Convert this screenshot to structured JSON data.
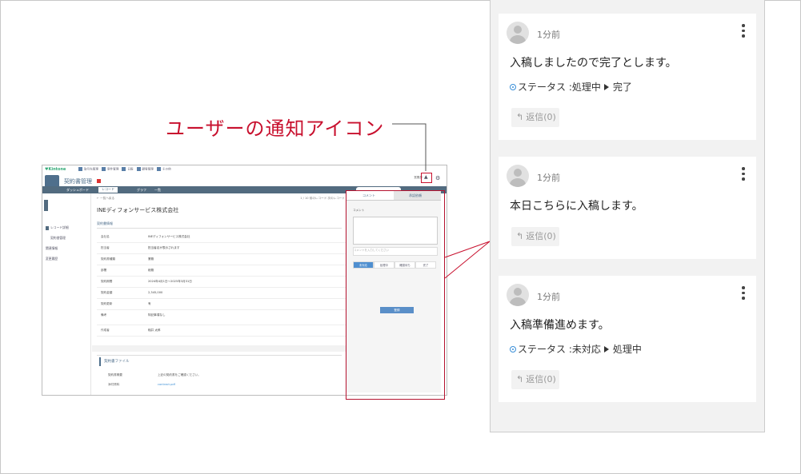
{
  "callout": {
    "label": "ユーザーの通知アイコン"
  },
  "mini_app": {
    "logo": "♥Kintone",
    "top_links": [
      "取引先管理",
      "案件管理",
      "日報",
      "顧客管理",
      "その他"
    ],
    "app_title": "契約書管理",
    "user_label": "営業部",
    "nav": [
      "ダッシュボード",
      "レコード",
      "グラフ",
      "一覧"
    ],
    "sidebar": [
      "レコード詳細",
      "契約書管理",
      "関連情報",
      "変更履歴"
    ],
    "back_link": "← 一覧へ戻る",
    "toolbar_text": "1 / 10    前のレコード  次のレコード",
    "company_name": "INEディフォンサービス株式会社",
    "section_title": "契約書情報",
    "fields": [
      {
        "k": "会社名",
        "v": "INEディフォンサービス株式会社"
      },
      {
        "k": "担当者",
        "v": "担当者名が表示されます"
      },
      {
        "k": "契約書種類",
        "v": "業務"
      },
      {
        "k": "部署",
        "v": "総務"
      },
      {
        "k": "契約期間",
        "v": "2024年4月1日〜2025年3月31日"
      },
      {
        "k": "契約金額",
        "v": "2,345,000"
      },
      {
        "k": "契約更新",
        "v": "有"
      },
      {
        "k": "備考",
        "v": "特記事項なし"
      },
      {
        "k": "作成者",
        "v": "稲井 太郎"
      }
    ],
    "sub_title": "契約書ファイル",
    "sub_rows": [
      {
        "k": "契約書概要",
        "v": "上記の契約書をご確認ください。"
      },
      {
        "k": "添付資料",
        "v": "contract.pdf"
      }
    ],
    "comment_tabs": [
      "コメント",
      "承認依頼"
    ],
    "comment_label": "コメント",
    "comment_input_placeholder": "コメントを入力してください",
    "status_steps": [
      "未対応",
      "処理中",
      "確認待ち",
      "完了"
    ],
    "submit_label": "登録"
  },
  "comments": [
    {
      "time": "1分前",
      "message": "入稿しましたので完了とします。",
      "status_label": "ステータス :",
      "from": "処理中",
      "to": "完了",
      "reply": "返信(0)"
    },
    {
      "time": "1分前",
      "message": "本日こちらに入稿します。",
      "reply": "返信(0)"
    },
    {
      "time": "1分前",
      "message": "入稿準備進めます。",
      "status_label": "ステータス :",
      "from": "未対応",
      "to": "処理中",
      "reply": "返信(0)"
    }
  ],
  "colors": {
    "accent_red": "#c8102e",
    "status_blue": "#3a8fd8",
    "nav": "#526b7f"
  },
  "icons": [
    "avatar-icon",
    "kebab-menu-icon",
    "reply-arrow-icon",
    "status-dot-icon",
    "arrow-right-icon",
    "bell-icon",
    "gear-icon"
  ]
}
